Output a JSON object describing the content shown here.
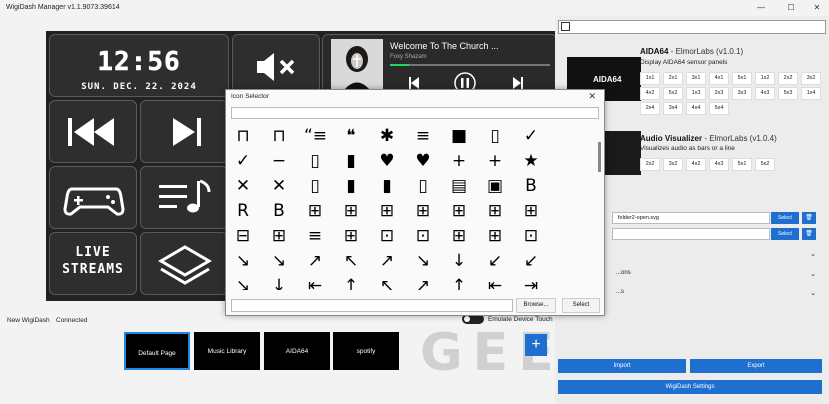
{
  "window": {
    "title": "WigiDash Manager v1.1.9073.39614",
    "minimize": "—",
    "maximize": "☐",
    "close": "✕"
  },
  "device": {
    "clock": {
      "time": "12:56",
      "date": "SUN. DEC. 22. 2024"
    },
    "live_streams": "LIVE\nSTREAMS",
    "music": {
      "title": "Welcome To The Church ...",
      "artist": "Foxy Shazam",
      "progress": 0.12
    }
  },
  "status": {
    "device_name": "New WigiDash",
    "connection": "Connected",
    "emulate_label": "Emulate Device Touch"
  },
  "pages": [
    {
      "label": "Default Page"
    },
    {
      "label": "Music Library"
    },
    {
      "label": "AIDA64"
    },
    {
      "label": "spotify"
    }
  ],
  "add_page": "+",
  "widgets": [
    {
      "name": "AIDA64",
      "author": "- ElmorLabs (v1.0.1)",
      "desc": "Display AIDA64 sensor panels",
      "logo": "AIDA64",
      "sizes": [
        "1x1",
        "2x1",
        "3x1",
        "4x1",
        "5x1",
        "1x2",
        "2x2",
        "3x2",
        "4x2",
        "5x2",
        "1x3",
        "2x3",
        "3x3",
        "4x3",
        "5x3",
        "1x4",
        "2x4",
        "3x4",
        "4x4",
        "5x4"
      ]
    },
    {
      "name": "Audio Visualizer",
      "author": "- ElmorLabs (v1.0.4)",
      "desc": "Visualizes audio as bars or a line",
      "sizes": [
        "2x2",
        "3x2",
        "4x2",
        "4x3",
        "5x1",
        "5x2"
      ]
    }
  ],
  "props": {
    "icon_path": "folder2-open.svg",
    "select_label": "Select",
    "delete_icon": "trash-icon",
    "section1": "...ons",
    "section2": "...s"
  },
  "bottom": {
    "import_label": "Import",
    "export_label": "Export",
    "settings_label": "WigiDash Settings"
  },
  "watermark": "GEEKNETIC",
  "dialog": {
    "title": "Icon Selector",
    "close": "✕",
    "browse_label": "Browse...",
    "select_label": "Select",
    "icons": [
      [
        "⊓",
        "⊓",
        "“≡",
        "❝",
        "✱",
        "≡",
        "■",
        "▯",
        "✓"
      ],
      [
        "✓",
        "−",
        "▯",
        "▮",
        "♥",
        "♥",
        "+",
        "+",
        "★"
      ],
      [
        "✕",
        "✕",
        "▯",
        "▮",
        "▮",
        "▯",
        "▤",
        "▣",
        "B"
      ],
      [
        "R",
        "B",
        "⊞",
        "⊞",
        "⊞",
        "⊞",
        "⊞",
        "⊞",
        "⊞"
      ],
      [
        "⊟",
        "⊞",
        "≡",
        "⊞",
        "⊡",
        "⊡",
        "⊞",
        "⊞",
        "⊡"
      ],
      [
        "↘",
        "↘",
        "↗",
        "↖",
        "↗",
        "↘",
        "↓",
        "↙",
        "↙"
      ],
      [
        "↘",
        "↓",
        "⇤",
        "↑",
        "↖",
        "↗",
        "↑",
        "⇤",
        "⇥"
      ]
    ]
  }
}
